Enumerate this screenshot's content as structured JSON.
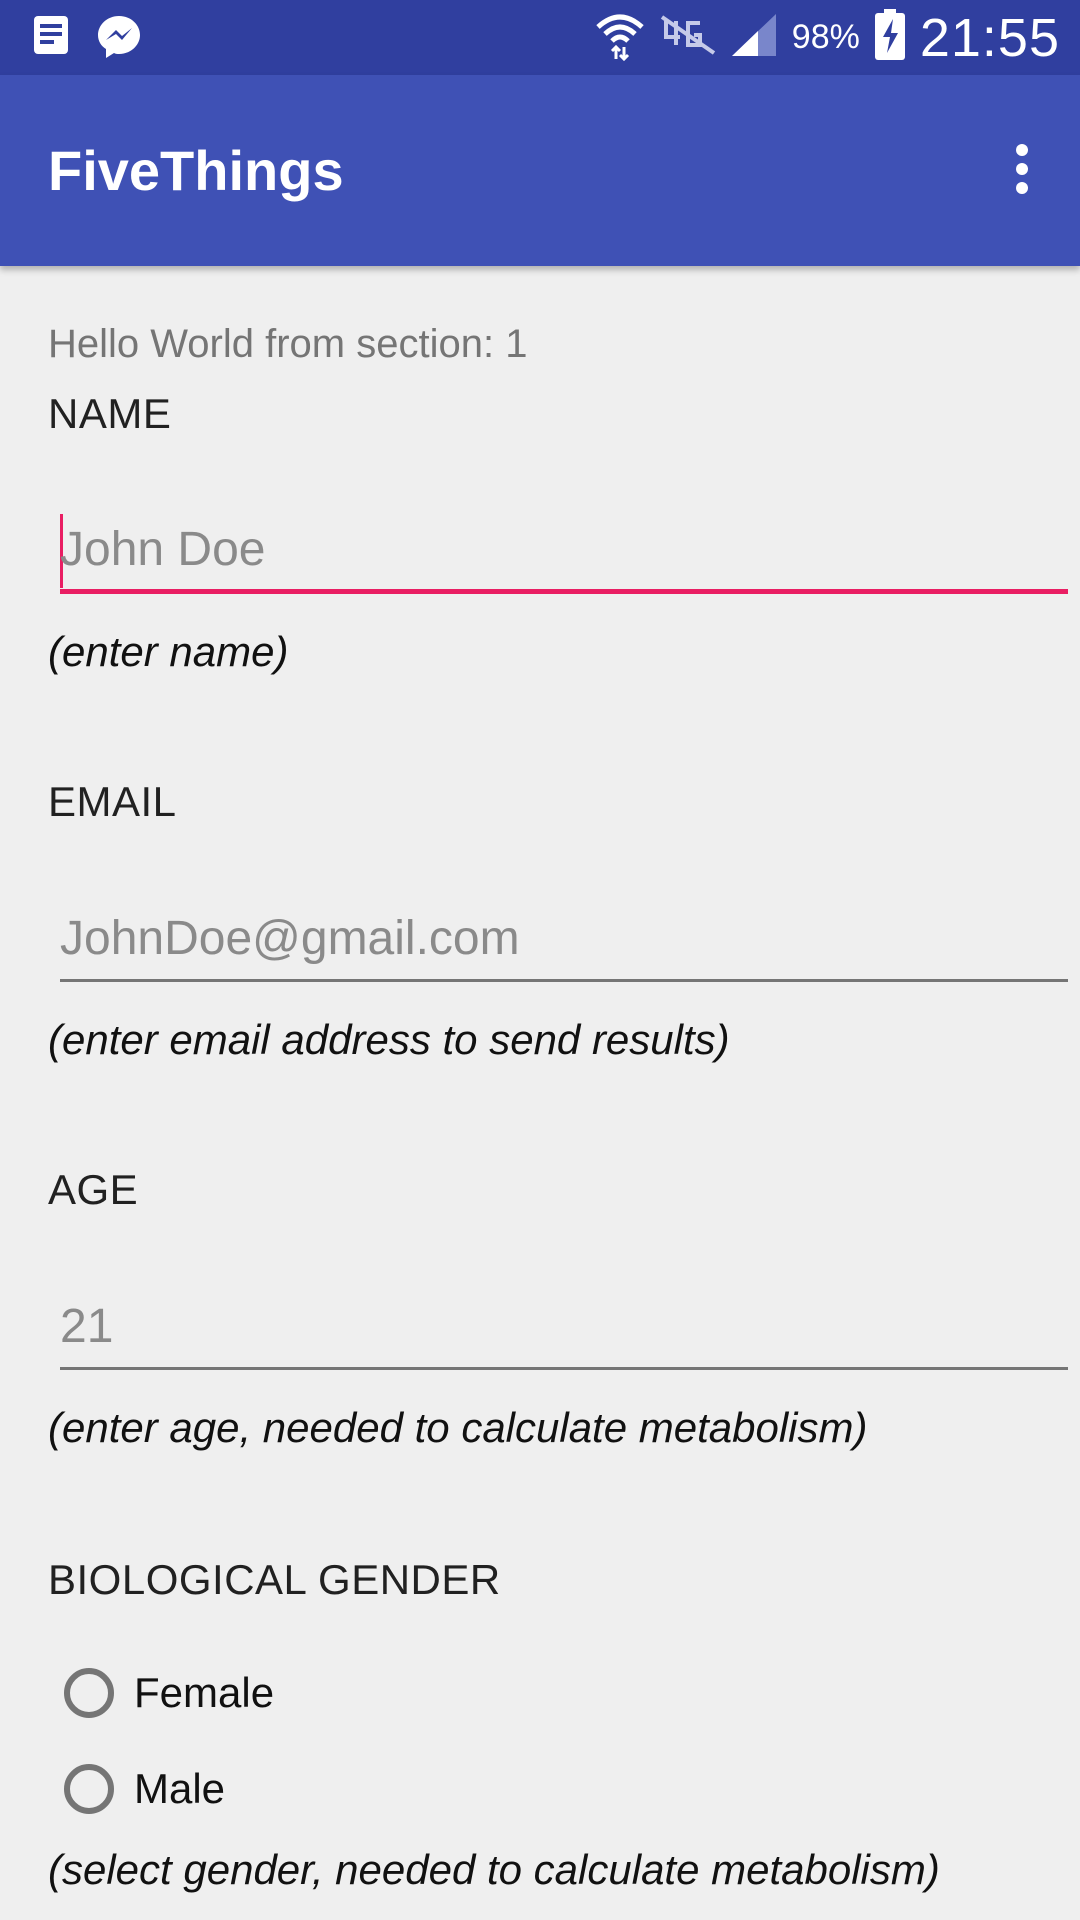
{
  "status_bar": {
    "icons_left": [
      "notes-icon",
      "messenger-icon"
    ],
    "icons_right": [
      "wifi-icon",
      "no-lte-icon",
      "signal-icon",
      "battery-charging-icon"
    ],
    "battery_percent": "98%",
    "time": "21:55"
  },
  "app_bar": {
    "title": "FiveThings",
    "overflow_icon": "more-vert-icon"
  },
  "form": {
    "section_text": "Hello World from section: 1",
    "name": {
      "label": "NAME",
      "placeholder": "John Doe",
      "value": "",
      "hint": "(enter name)"
    },
    "email": {
      "label": "EMAIL",
      "placeholder": "JohnDoe@gmail.com",
      "value": "",
      "hint": "(enter email address to send results)"
    },
    "age": {
      "label": "AGE",
      "placeholder": "21",
      "value": "",
      "hint": "(enter age, needed to calculate metabolism)"
    },
    "gender": {
      "label": "BIOLOGICAL GENDER",
      "options": [
        "Female",
        "Male"
      ],
      "selected": null,
      "hint": "(select gender, needed to calculate metabolism)"
    }
  },
  "colors": {
    "status_bar": "#303f9f",
    "primary": "#3f51b5",
    "accent": "#e91e63",
    "background": "#efefef"
  }
}
